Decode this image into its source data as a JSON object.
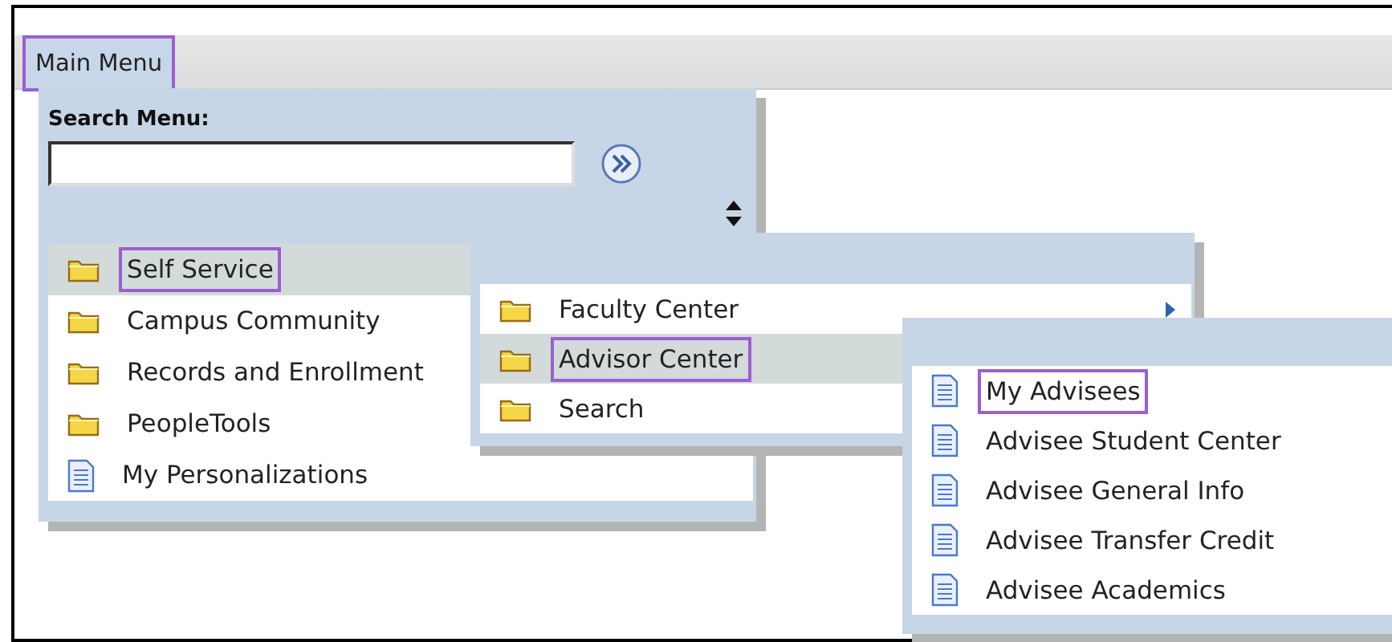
{
  "menu_bar": {
    "label": "Main Menu",
    "highlighted": true
  },
  "main_menu": {
    "search_label": "Search Menu:",
    "items": [
      {
        "label": "Self Service",
        "kind": "folder",
        "selected": true,
        "highlighted": true
      },
      {
        "label": "Campus Community",
        "kind": "folder",
        "selected": false,
        "highlighted": false
      },
      {
        "label": "Records and Enrollment",
        "kind": "folder",
        "selected": false,
        "highlighted": false
      },
      {
        "label": "PeopleTools",
        "kind": "folder",
        "selected": false,
        "highlighted": false
      },
      {
        "label": "My Personalizations",
        "kind": "page",
        "selected": false,
        "highlighted": false
      }
    ]
  },
  "submenu": {
    "items": [
      {
        "label": "Faculty Center",
        "kind": "folder",
        "selected": false,
        "highlighted": false,
        "arrow": true
      },
      {
        "label": "Advisor Center",
        "kind": "folder",
        "selected": true,
        "highlighted": true
      },
      {
        "label": "Search",
        "kind": "folder",
        "selected": false,
        "highlighted": false
      }
    ]
  },
  "advisor_menu": {
    "items": [
      {
        "label": "My Advisees",
        "kind": "page",
        "selected": false,
        "highlighted": true
      },
      {
        "label": "Advisee Student Center",
        "kind": "page",
        "selected": false,
        "highlighted": false
      },
      {
        "label": "Advisee General Info",
        "kind": "page",
        "selected": false,
        "highlighted": false
      },
      {
        "label": "Advisee Transfer Credit",
        "kind": "page",
        "selected": false,
        "highlighted": false
      },
      {
        "label": "Advisee Academics",
        "kind": "page",
        "selected": false,
        "highlighted": false
      }
    ]
  }
}
